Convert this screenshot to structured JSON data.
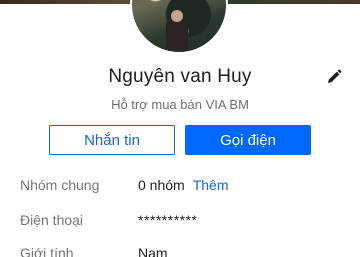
{
  "profile": {
    "name": "Nguyên van Huy",
    "subtitle": "Hỗ trợ mua bán VIA BM",
    "edit_icon": "pencil-icon"
  },
  "actions": {
    "message_label": "Nhắn tin",
    "call_label": "Gọi điện"
  },
  "info": {
    "group_label": "Nhóm chung",
    "group_value": "0 nhóm",
    "group_action": "Thêm",
    "phone_label": "Điện thoại",
    "phone_value": "**********",
    "gender_label": "Giới tính",
    "gender_value": "Nam"
  },
  "colors": {
    "primary": "#0068ff",
    "link": "#1565d8",
    "label_gray": "#72767c",
    "text": "#1c1e21"
  }
}
